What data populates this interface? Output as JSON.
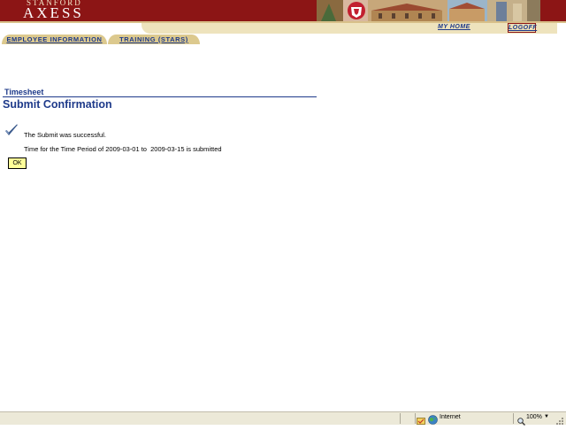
{
  "header": {
    "logo_line1": "STANFORD",
    "logo_line2": "AXESS",
    "my_home": "MY HOME",
    "logoff": "LOGOFF",
    "brand_color": "#8c1515",
    "accent_color": "#dcc98e"
  },
  "tabs": [
    {
      "label": "EMPLOYEE INFORMATION"
    },
    {
      "label": "TRAINING (STARS)"
    }
  ],
  "content": {
    "section_label": "Timesheet",
    "title": "Submit Confirmation",
    "message": "The Submit was successful.",
    "period_text": "Time for the Time Period of 2009-03-01 to  2009-03-15 is submitted",
    "ok_label": "OK",
    "status_icon": "checkmark-icon",
    "text_color": "#1e3a8a"
  },
  "statusbar": {
    "zone": "Internet",
    "zoom": "100%",
    "zone_icon": "globe-icon"
  }
}
